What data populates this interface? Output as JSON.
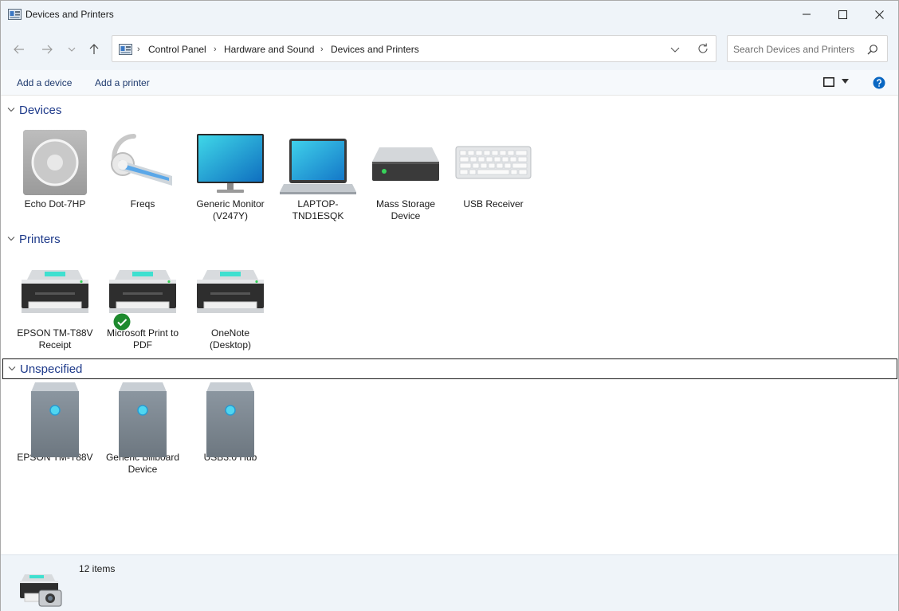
{
  "window": {
    "title": "Devices and Printers"
  },
  "nav": {
    "breadcrumb": [
      "Control Panel",
      "Hardware and Sound",
      "Devices and Printers"
    ]
  },
  "search": {
    "placeholder": "Search Devices and Printers"
  },
  "commands": {
    "add_device": "Add a device",
    "add_printer": "Add a printer"
  },
  "groups": {
    "devices": {
      "label": "Devices",
      "items": [
        {
          "label": "Echo Dot-7HP",
          "icon": "speaker-icon"
        },
        {
          "label": "Freqs",
          "icon": "headset-icon"
        },
        {
          "label": "Generic Monitor (V247Y)",
          "icon": "monitor-icon"
        },
        {
          "label": "LAPTOP-TND1ESQK",
          "icon": "laptop-icon"
        },
        {
          "label": "Mass Storage Device",
          "icon": "drive-icon"
        },
        {
          "label": "USB Receiver",
          "icon": "keyboard-icon"
        }
      ]
    },
    "printers": {
      "label": "Printers",
      "items": [
        {
          "label": "EPSON TM-T88V Receipt",
          "icon": "printer-icon"
        },
        {
          "label": "Microsoft Print to PDF",
          "icon": "printer-icon",
          "default": true
        },
        {
          "label": "OneNote (Desktop)",
          "icon": "printer-icon"
        }
      ]
    },
    "unspecified": {
      "label": "Unspecified",
      "items": [
        {
          "label": "EPSON TM-T88V",
          "icon": "generic-device-icon"
        },
        {
          "label": "Generic Billboard Device",
          "icon": "generic-device-icon"
        },
        {
          "label": "USB3.0 Hub",
          "icon": "generic-device-icon"
        }
      ]
    }
  },
  "status": {
    "count": "12 items"
  },
  "colors": {
    "chrome": "#eff4f9",
    "group_header": "#1e3a8a",
    "command_text": "#1e3a6e",
    "default_check": "#1e8a2e",
    "help": "#0a67c2"
  }
}
